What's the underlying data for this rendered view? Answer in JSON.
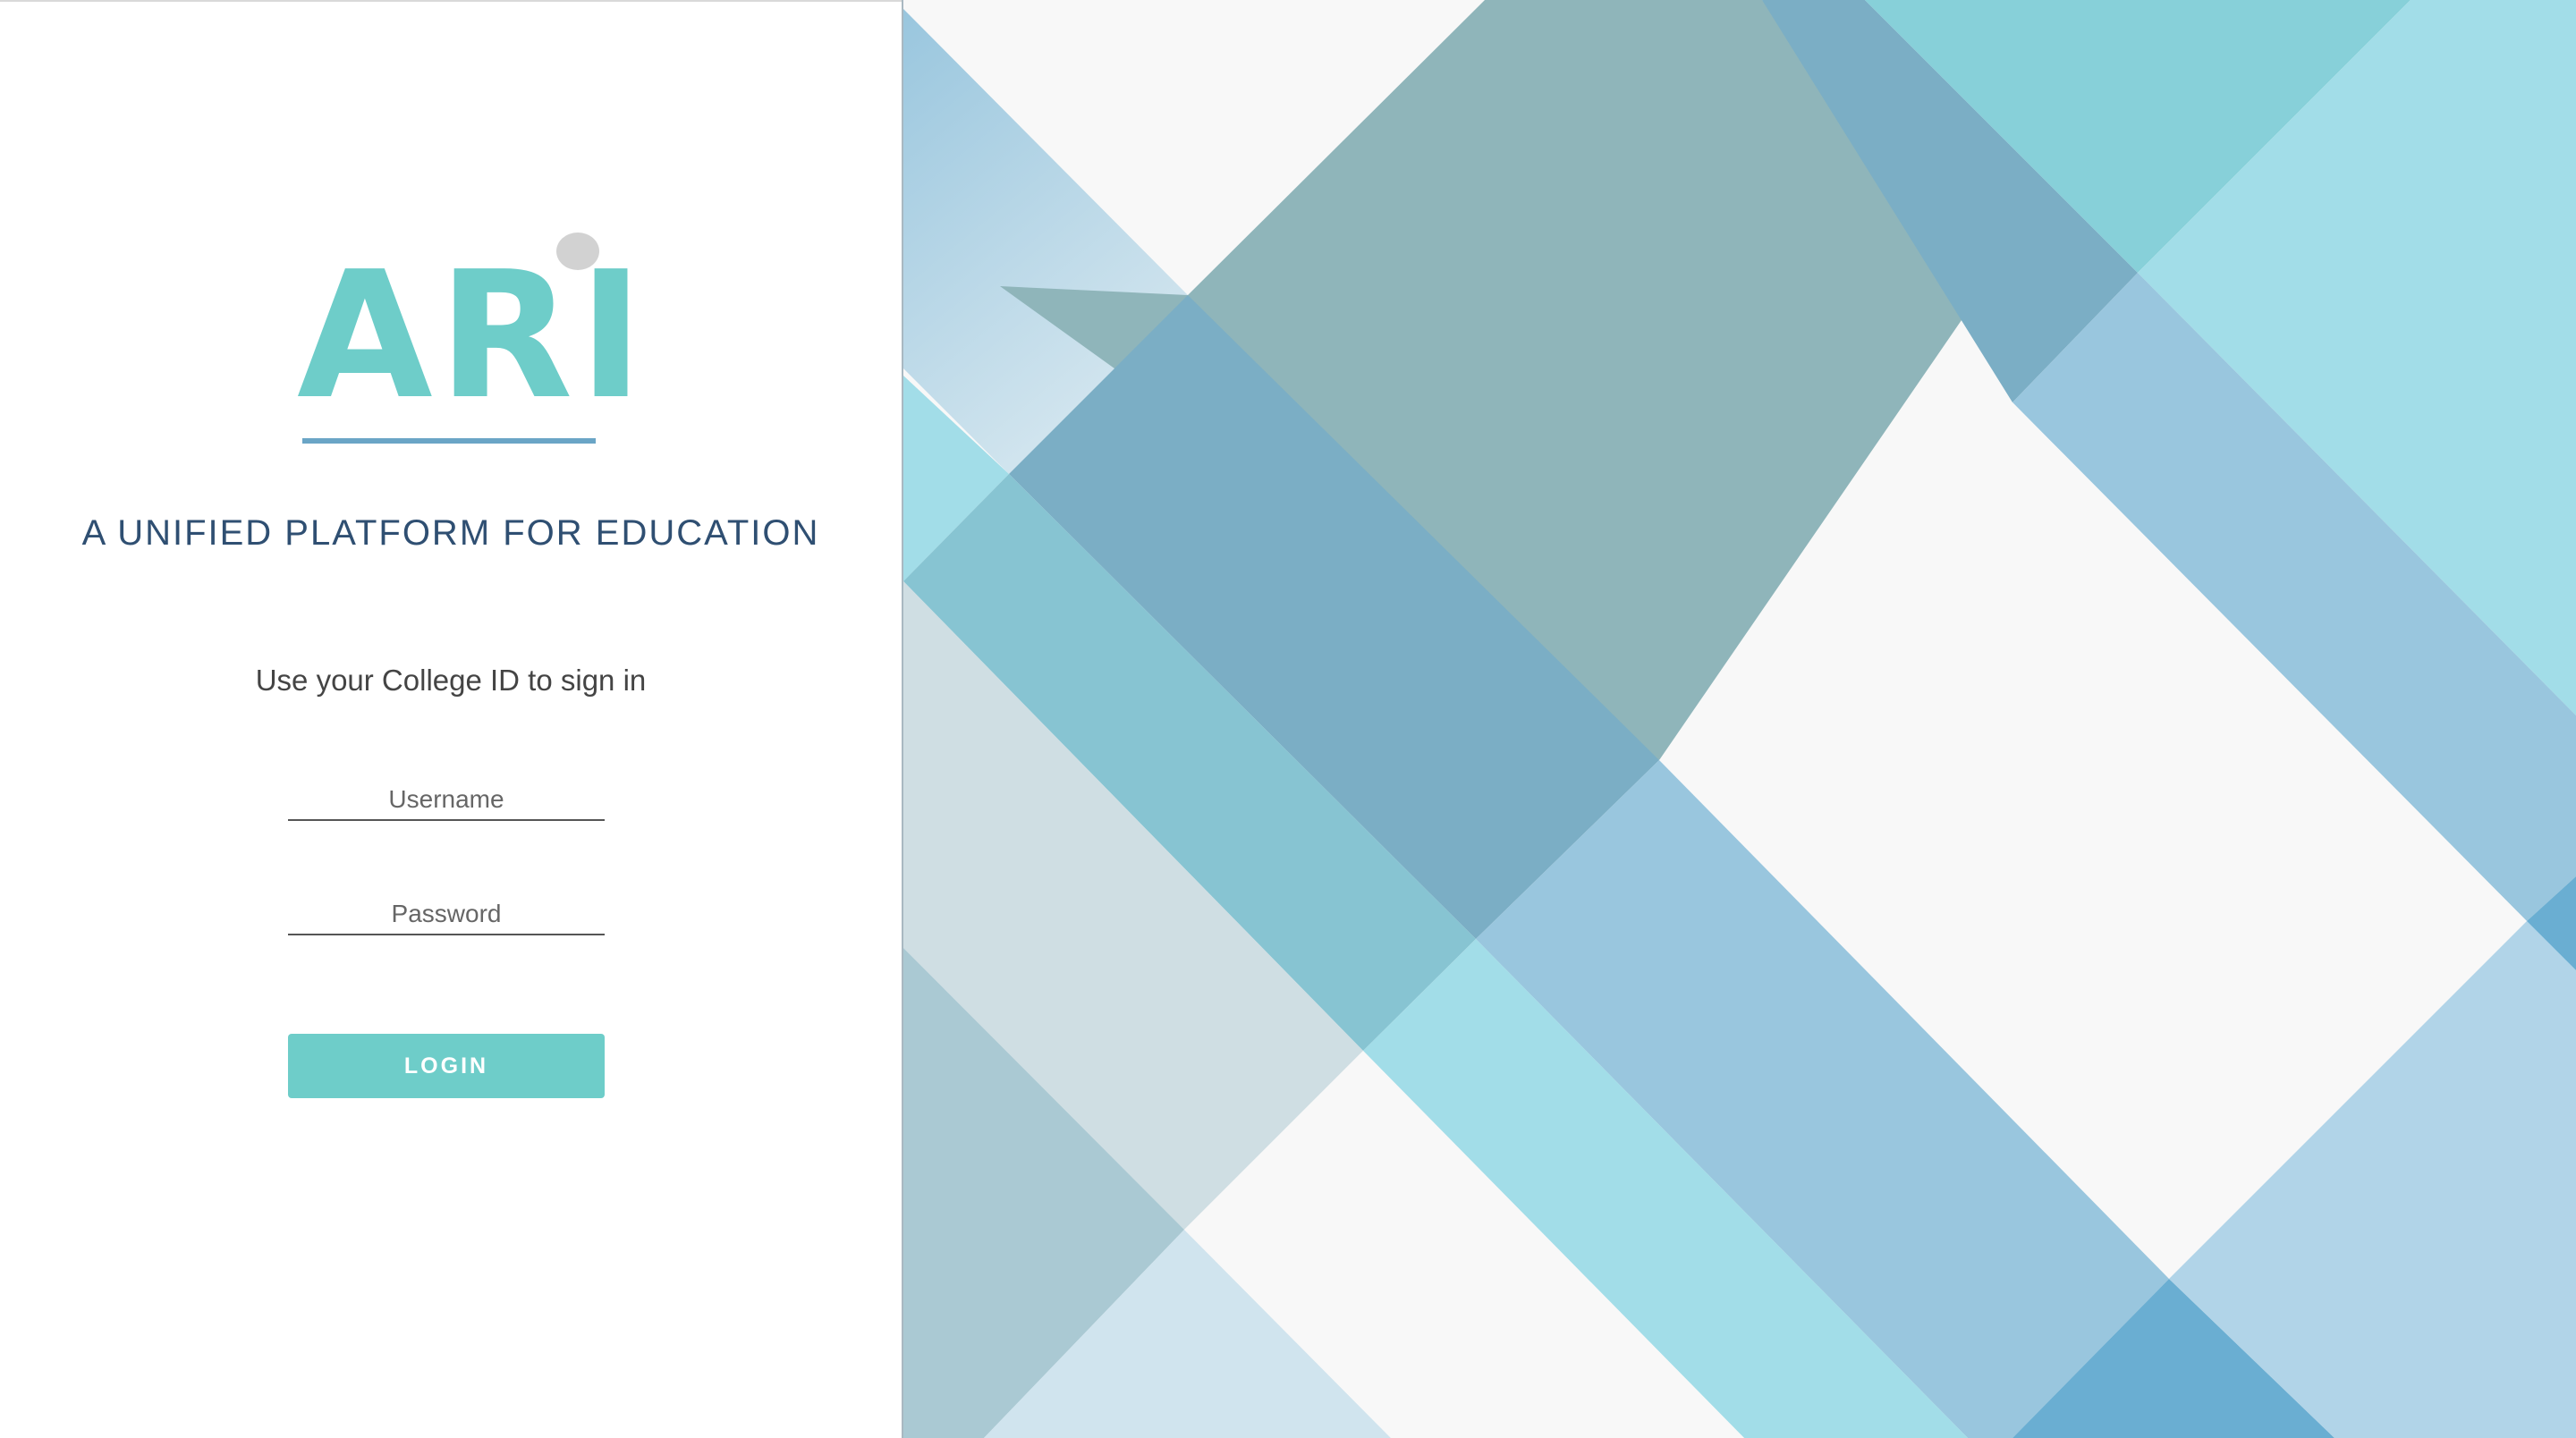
{
  "brand": {
    "logo_text": "ARI",
    "logo_color": "#6ecdc9",
    "logo_dot_color": "#d2d2d2",
    "underline_color": "#6aa5c6"
  },
  "tagline": "A UNIFIED PLATFORM FOR EDUCATION",
  "login_form": {
    "instructions": "Use your College ID to sign in",
    "username_placeholder": "Username",
    "username_value": "",
    "password_placeholder": "Password",
    "password_value": "",
    "login_label": "LOGIN",
    "button_color": "#6ecdc9"
  },
  "background": {
    "description_colors": [
      "#f8f8f8",
      "#8fb5ba",
      "#7baec5",
      "#87d0d9",
      "#a2dde8",
      "#99c6de",
      "#cfdee3",
      "#aac9d3",
      "#6aaed2",
      "#b1d4e8"
    ]
  }
}
